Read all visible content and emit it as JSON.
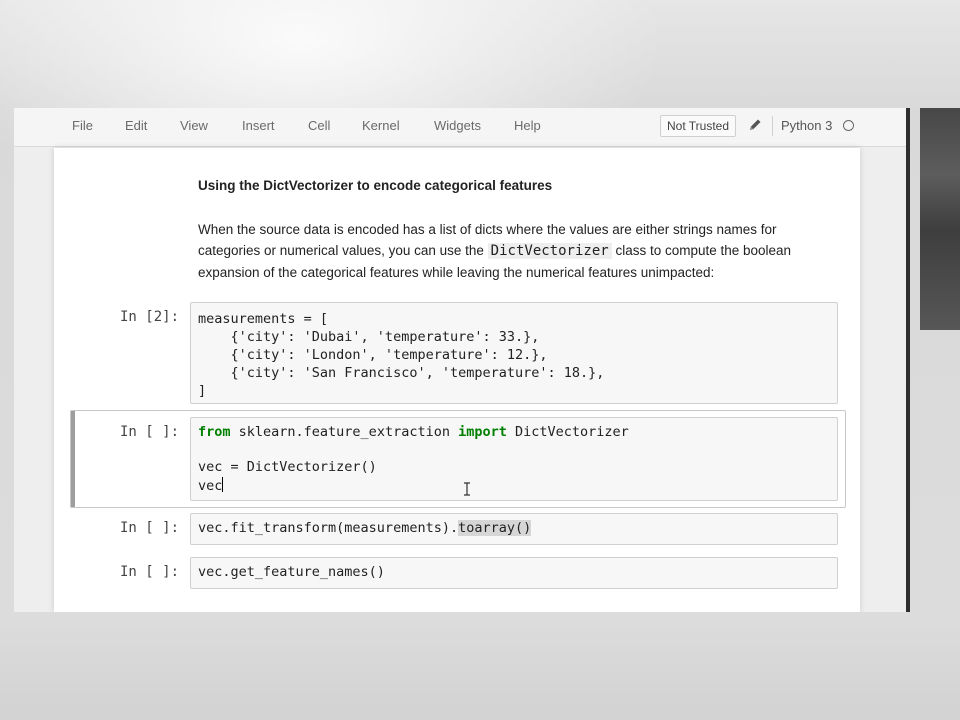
{
  "menubar": {
    "items": [
      "File",
      "Edit",
      "View",
      "Insert",
      "Cell",
      "Kernel",
      "Widgets",
      "Help"
    ],
    "trusted_label": "Not Trusted",
    "kernel_name": "Python 3"
  },
  "markdown": {
    "heading": "Using the DictVectorizer to encode categorical features",
    "para_part1": "When the source data is encoded has a list of dicts where the values are either strings names for categories or numerical values, you can use the ",
    "para_code": "DictVectorizer",
    "para_part2": " class to compute the boolean expansion of the categorical features while leaving the numerical features unimpacted:"
  },
  "cells": [
    {
      "prompt": "In [2]:",
      "lines": [
        "measurements = [",
        "    {'city': 'Dubai', 'temperature': 33.},",
        "    {'city': 'London', 'temperature': 12.},",
        "    {'city': 'San Francisco', 'temperature': 18.},",
        "]"
      ]
    },
    {
      "prompt": "In [ ]:",
      "kw_from": "from",
      "module": " sklearn.feature_extraction ",
      "kw_import": "import",
      "name": " DictVectorizer",
      "line3": "vec = DictVectorizer()",
      "line4": "vec"
    },
    {
      "prompt": "In [ ]:",
      "code_plain": "vec.fit_transform(measurements).",
      "code_highlight": "toarray()"
    },
    {
      "prompt": "In [ ]:",
      "code": "vec.get_feature_names()"
    }
  ],
  "icons": {
    "pencil": "pencil-icon",
    "kernel_status": "kernel-idle-circle-icon",
    "text_cursor": "ibeam-cursor-icon"
  },
  "colors": {
    "keyword": "#008000",
    "selected_cell_bar": "#9e9e9e"
  }
}
